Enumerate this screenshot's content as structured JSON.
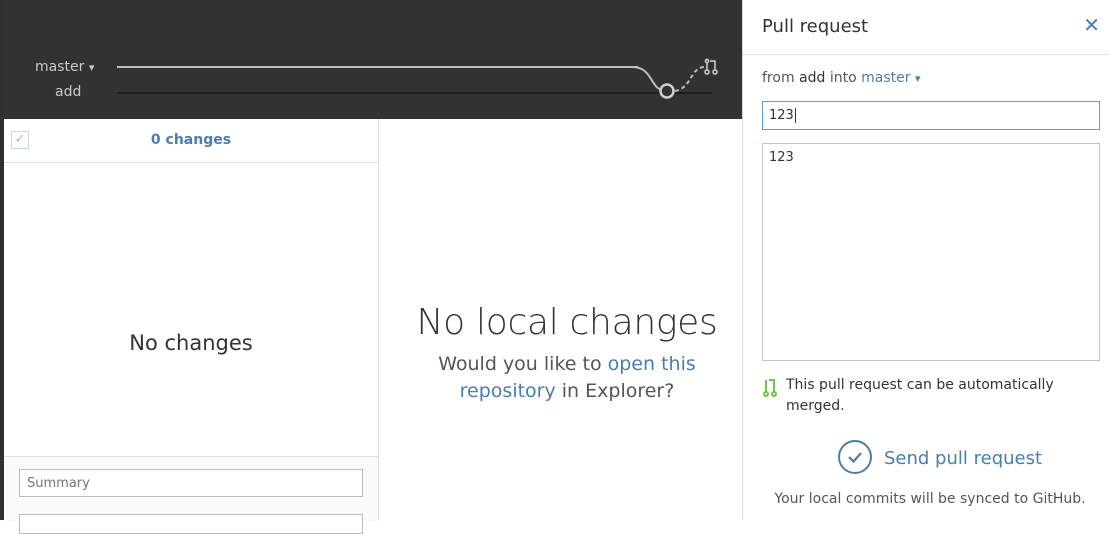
{
  "graph": {
    "branches": [
      "master",
      "add"
    ],
    "current_branch_label": "master",
    "other_branch_label": "add",
    "dropdown_caret": "▾"
  },
  "changes": {
    "count_label": "0 changes",
    "empty_label": "No changes",
    "summary_placeholder": "Summary"
  },
  "center": {
    "title": "No local changes",
    "prompt_prefix": "Would you like to ",
    "link_text": "open this repository",
    "prompt_suffix": " in Explorer?"
  },
  "pull_request": {
    "panel_title": "Pull request",
    "close_glyph": "✕",
    "from_label": "from",
    "from_branch": "add",
    "into_label": "into",
    "into_branch": "master",
    "into_caret": "▾",
    "title_value": "123",
    "body_value": "123",
    "merge_status": "This pull request can be automatically merged.",
    "send_label": "Send pull request",
    "sync_note": "Your local commits will be synced to GitHub."
  },
  "colors": {
    "accent": "#4a7cb0",
    "header_bg": "#323232",
    "merge_green": "#6cc644"
  },
  "icons": {
    "checkbox": "checkmark-icon",
    "close": "close-icon",
    "merge": "git-merge-icon",
    "send": "check-circle-icon",
    "pull_request_node": "pull-request-icon"
  }
}
